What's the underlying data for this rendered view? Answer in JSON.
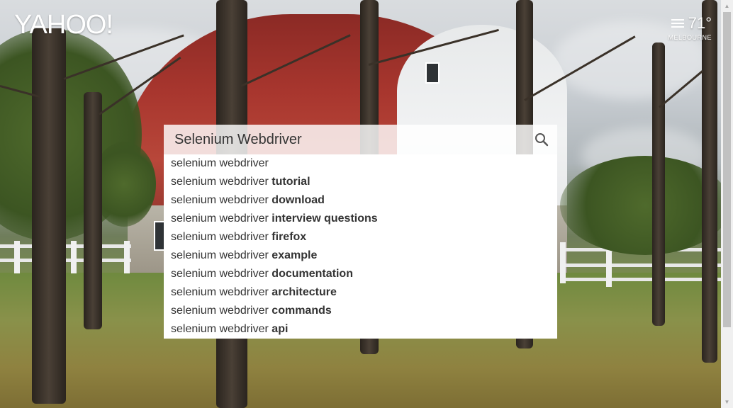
{
  "header": {
    "logo_text": "YAHOO!",
    "weather": {
      "icon": "fog-icon",
      "temperature": "71°",
      "city": "MELBOURNE"
    }
  },
  "search": {
    "value": "Selenium Webdriver",
    "button_icon": "search-icon"
  },
  "suggestions": [
    {
      "prefix": "selenium webdriver",
      "bold": ""
    },
    {
      "prefix": "selenium webdriver",
      "bold": "tutorial"
    },
    {
      "prefix": "selenium webdriver",
      "bold": "download"
    },
    {
      "prefix": "selenium webdriver",
      "bold": "interview questions"
    },
    {
      "prefix": "selenium webdriver",
      "bold": "firefox"
    },
    {
      "prefix": "selenium webdriver",
      "bold": "example"
    },
    {
      "prefix": "selenium webdriver",
      "bold": "documentation"
    },
    {
      "prefix": "selenium webdriver",
      "bold": "architecture"
    },
    {
      "prefix": "selenium webdriver",
      "bold": "commands"
    },
    {
      "prefix": "selenium webdriver",
      "bold": "api"
    }
  ],
  "colors": {
    "text": "#333333",
    "dropdown_bg": "#ffffff"
  }
}
